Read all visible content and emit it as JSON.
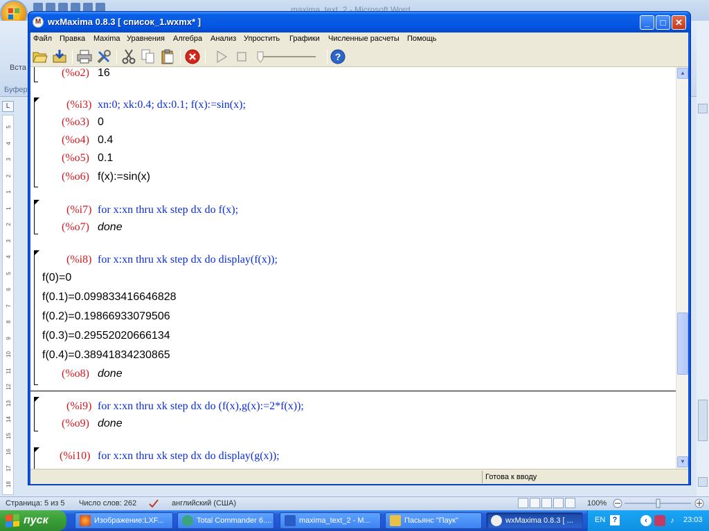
{
  "word": {
    "title": "maxima_text_2 - Microsoft Word",
    "paste_label": "Вста",
    "clipboard_label": "Буфер",
    "ruler_corner": "L",
    "ruler_ticks": [
      "5",
      "4",
      "3",
      "2",
      "1",
      "1",
      "2",
      "3",
      "4",
      "5",
      "6",
      "7",
      "8",
      "9",
      "10",
      "11",
      "12",
      "13",
      "14",
      "15",
      "16",
      "17",
      "18"
    ],
    "status": {
      "page": "Страница: 5 из 5",
      "words": "Число слов: 262",
      "language": "английский (США)",
      "zoom": "100%"
    }
  },
  "wx": {
    "title": "wxMaxima 0.8.3 [ список_1.wxmx* ]",
    "app_icon_letter": "M",
    "caption_buttons": {
      "minimize": "_",
      "maximize": "□",
      "close": "✕"
    },
    "menu": [
      "Файл",
      "Правка",
      "Maxima",
      "Уравнения",
      "Алгебра",
      "Анализ",
      "Упростить",
      "Графики",
      "Численные расчеты",
      "Помощь"
    ],
    "toolbar_icons": [
      "open-icon",
      "save-icon",
      "print-icon",
      "settings-icon",
      "cut-icon",
      "copy-icon",
      "paste-icon",
      "interrupt-icon",
      "play-icon",
      "stop-icon",
      "animation-slider",
      "help-icon"
    ],
    "status": "Готова к вводу"
  },
  "cells": [
    {
      "outputs": [
        {
          "label": "(%o2)",
          "value": "16"
        }
      ]
    },
    {
      "label": "(%i3)",
      "input": "xn:0; xk:0.4; dx:0.1; f(x):=sin(x);",
      "outputs": [
        {
          "label": "(%o3)",
          "value": "0"
        },
        {
          "label": "(%o4)",
          "value": "0.4"
        },
        {
          "label": "(%o5)",
          "value": "0.1"
        },
        {
          "label": "(%o6)",
          "value": "f(x):=sin(x)"
        }
      ]
    },
    {
      "label": "(%i7)",
      "input": "for x:xn thru xk step dx do f(x);",
      "outputs": [
        {
          "label": "(%o7)",
          "value": "done"
        }
      ]
    },
    {
      "label": "(%i8)",
      "input": "for x:xn thru xk step dx do display(f(x));",
      "display": [
        "f(0)=0",
        "f(0.1)=0.099833416646828",
        "f(0.2)=0.19866933079506",
        "f(0.3)=0.29552020666134",
        "f(0.4)=0.38941834230865"
      ],
      "outputs": [
        {
          "label": "(%o8)",
          "value": "done"
        }
      ]
    },
    {
      "label": "(%i9)",
      "input": "for x:xn thru xk step dx do (f(x),g(x):=2*f(x));",
      "outputs": [
        {
          "label": "(%o9)",
          "value": "done"
        }
      ]
    },
    {
      "label": "(%i10)",
      "input": "for x:xn thru xk step dx do display(g(x));"
    }
  ],
  "taskbar": {
    "start": "пуск",
    "tasks": [
      {
        "label": "Изображение:LXF...",
        "active": false
      },
      {
        "label": "Total Commander 6....",
        "active": false
      },
      {
        "label": "maxima_text_2 - M...",
        "active": false
      },
      {
        "label": "Пасьянс \"Паук\"",
        "active": false
      },
      {
        "label": "wxMaxima 0.8.3 [ ...",
        "active": true
      }
    ],
    "tray": {
      "lang": "EN",
      "time": "23:03"
    }
  },
  "colors": {
    "input_label": "#d2161c",
    "input_text": "#0a2dd8",
    "xp_blue": "#0558e4",
    "start_green": "#389e36"
  }
}
